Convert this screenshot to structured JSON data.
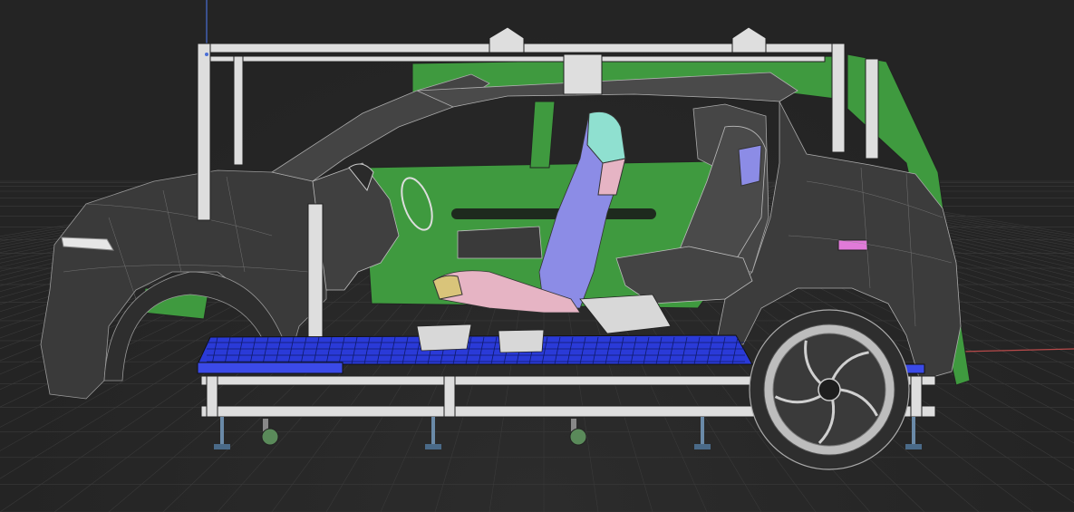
{
  "viewport": {
    "background": "#262626",
    "grid_color": "#3a3a3a",
    "axis_x_color": "#b84a4a",
    "axis_y_color": "#4a6fd6"
  },
  "model": {
    "body_color": "#3c3c3c",
    "body_edge_color": "#d0d0d0",
    "frame_color": "#dedede",
    "floor_grid_color": "#2a3ad8",
    "interior_panel_color": "#3f9a3f",
    "seat_blue": "#8c8ce6",
    "seat_pink": "#e6b4c4",
    "seat_cyan": "#8fe0d0",
    "label_magenta": "#e07ad8",
    "caster_green": "#5a8a5a",
    "icons": [
      "origin-axis-icon",
      "caster-wheel-icon",
      "leveling-foot-icon"
    ]
  }
}
